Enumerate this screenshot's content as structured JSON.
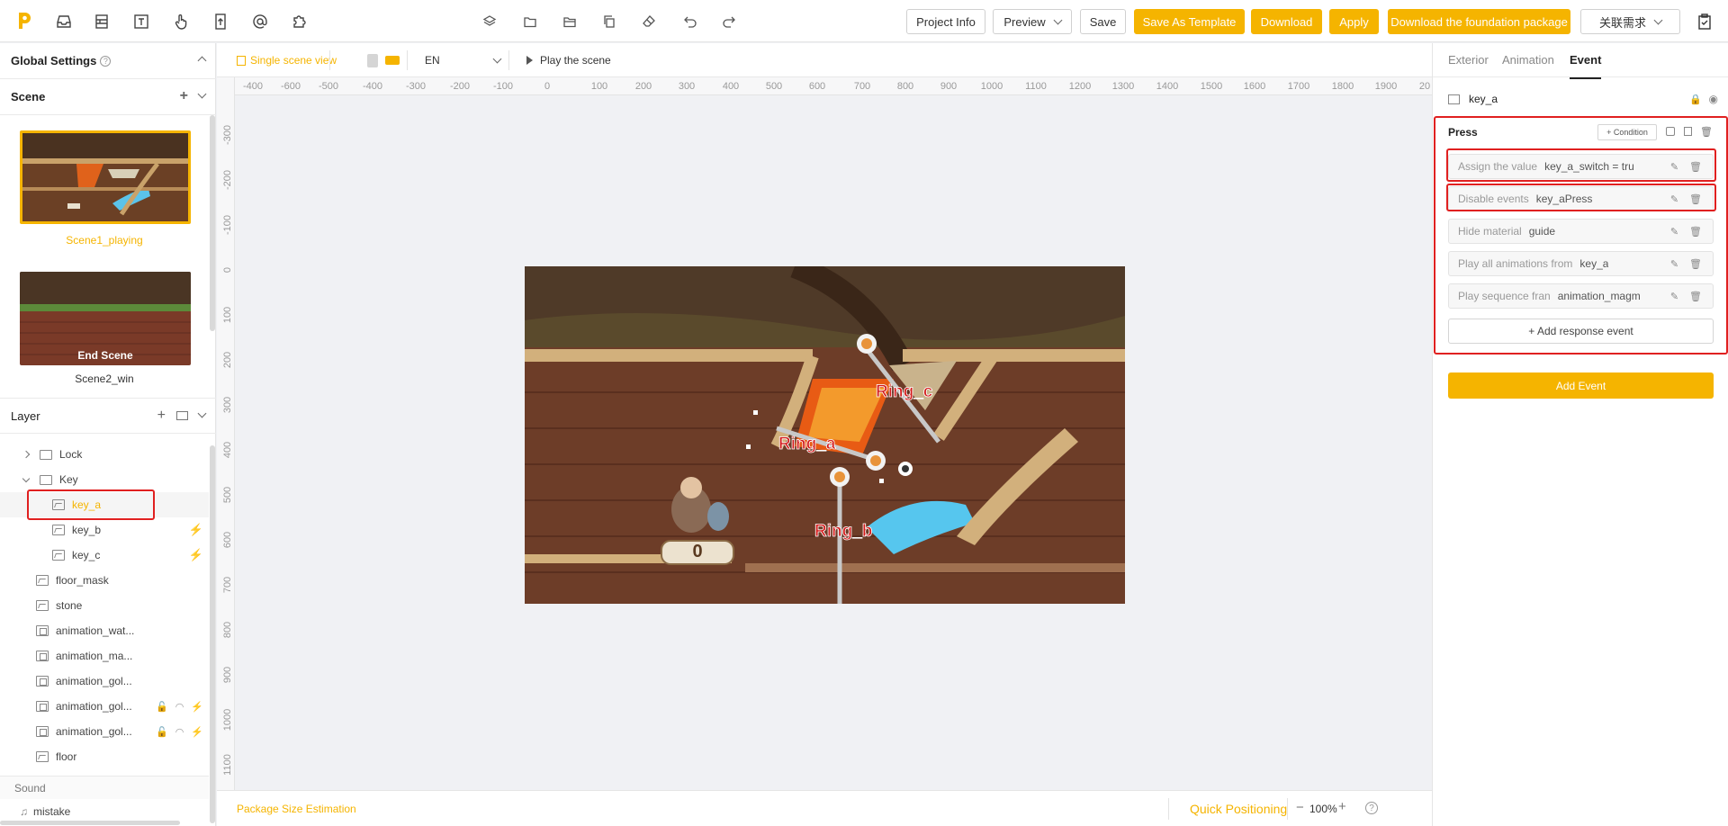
{
  "topbar": {
    "buttons": {
      "project_info": "Project Info",
      "preview": "Preview",
      "save": "Save",
      "save_as_template": "Save As Template",
      "download": "Download",
      "apply": "Apply",
      "download_foundation": "Download the foundation package",
      "linked_requirement": "关联需求"
    }
  },
  "left": {
    "global_settings": "Global Settings",
    "scene_header": "Scene",
    "scenes": [
      {
        "name": "Scene1_playing",
        "selected": true
      },
      {
        "name": "Scene2_win",
        "overlay": "End Scene"
      }
    ],
    "layer_header": "Layer",
    "layers": [
      {
        "name": "Lock",
        "type": "folder"
      },
      {
        "name": "Key",
        "type": "folder"
      },
      {
        "name": "key_a",
        "type": "image"
      },
      {
        "name": "key_b",
        "type": "image"
      },
      {
        "name": "key_c",
        "type": "image"
      },
      {
        "name": "floor_mask",
        "type": "image"
      },
      {
        "name": "stone",
        "type": "image"
      },
      {
        "name": "animation_wat...",
        "type": "anim"
      },
      {
        "name": "animation_ma...",
        "type": "anim"
      },
      {
        "name": "animation_gol...",
        "type": "anim"
      },
      {
        "name": "animation_gol...",
        "type": "anim"
      },
      {
        "name": "animation_gol...",
        "type": "anim"
      },
      {
        "name": "floor",
        "type": "image"
      }
    ],
    "sound_header": "Sound",
    "sounds": [
      "mistake"
    ]
  },
  "canvas": {
    "single_scene_view": "Single scene view",
    "language": "EN",
    "play_scene": "Play the scene",
    "ruler_x": [
      "-400",
      "-600",
      "-500",
      "-400",
      "-300",
      "-200",
      "-100",
      "0",
      "100",
      "200",
      "300",
      "400",
      "500",
      "600",
      "700",
      "800",
      "900",
      "1000",
      "1100",
      "1200",
      "1300",
      "1400",
      "1500",
      "1600",
      "1700",
      "1800",
      "1900",
      "20"
    ],
    "ruler_y": [
      "-300",
      "-200",
      "-100",
      "0",
      "100",
      "200",
      "300",
      "400",
      "500",
      "600",
      "700",
      "800",
      "900",
      "1000",
      "1100"
    ],
    "labels": {
      "ring_a": "Ring_a",
      "ring_b": "Ring_b",
      "ring_c": "Ring_c",
      "score": "0"
    },
    "footer": {
      "package_size": "Package Size Estimation",
      "quick_positioning": "Quick Positioning",
      "zoom": "100%",
      "minus": "−",
      "plus": "+",
      "help": "?"
    }
  },
  "right": {
    "tabs": [
      "Exterior",
      "Animation",
      "Event"
    ],
    "active_tab": "Event",
    "layer_name": "key_a",
    "trigger": "Press",
    "condition_button": "+ Condition",
    "events": [
      {
        "label": "Assign the value",
        "value": "key_a_switch = tru"
      },
      {
        "label": "Disable events",
        "value": "key_aPress"
      },
      {
        "label": "Hide material",
        "value": "guide"
      },
      {
        "label": "Play all animations from",
        "value": "key_a"
      },
      {
        "label": "Play sequence fran",
        "value": "animation_magm"
      }
    ],
    "add_response": "+ Add response event",
    "add_event": "Add Event"
  },
  "colors": {
    "accent": "#f5b400",
    "highlight": "#e02020"
  }
}
